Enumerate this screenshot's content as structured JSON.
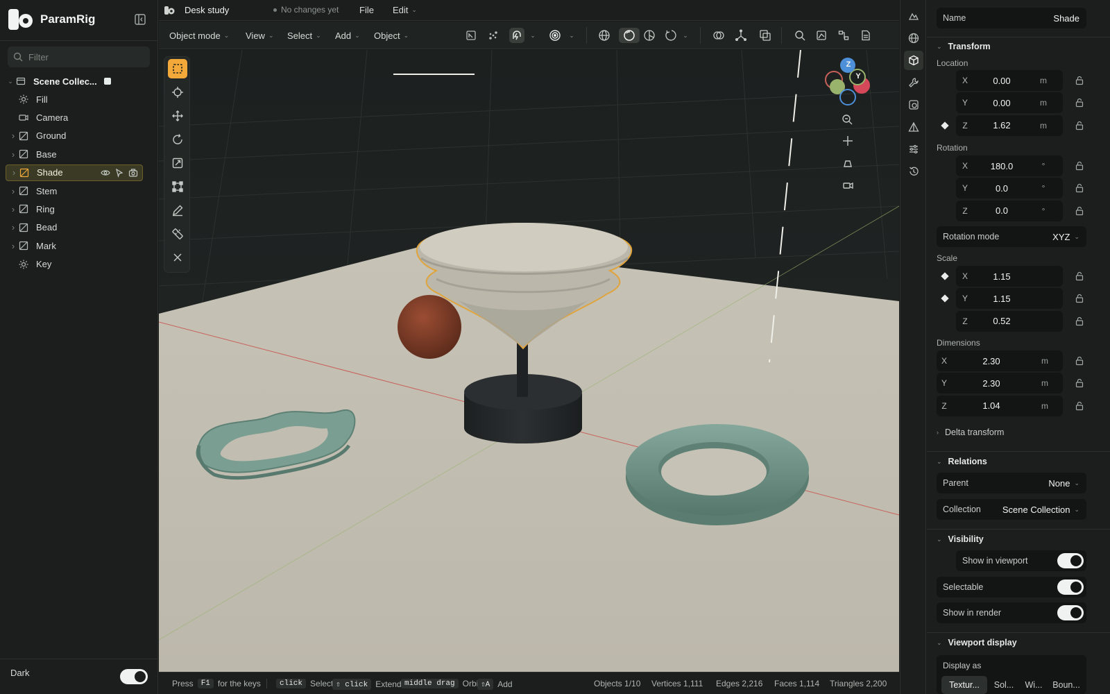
{
  "app": {
    "name": "ParamRig",
    "document_title": "Desk study",
    "save_status": "No changes yet"
  },
  "menus": {
    "file": "File",
    "edit": "Edit"
  },
  "sidebar": {
    "filter_placeholder": "Filter",
    "collection": "Scene Collec...",
    "items": [
      {
        "label": "Fill",
        "icon": "light-icon",
        "expandable": false
      },
      {
        "label": "Camera",
        "icon": "camera-icon",
        "expandable": false
      },
      {
        "label": "Ground",
        "icon": "mesh-icon",
        "expandable": true
      },
      {
        "label": "Base",
        "icon": "mesh-icon",
        "expandable": true
      },
      {
        "label": "Shade",
        "icon": "mesh-icon",
        "expandable": true,
        "selected": true
      },
      {
        "label": "Stem",
        "icon": "mesh-icon",
        "expandable": true
      },
      {
        "label": "Ring",
        "icon": "mesh-icon",
        "expandable": true
      },
      {
        "label": "Bead",
        "icon": "mesh-icon",
        "expandable": true
      },
      {
        "label": "Mark",
        "icon": "mesh-icon",
        "expandable": true
      },
      {
        "label": "Key",
        "icon": "light-icon",
        "expandable": false
      }
    ],
    "theme_label": "Dark",
    "theme_dark": true
  },
  "toolbar": {
    "mode": "Object mode",
    "view": "View",
    "select": "Select",
    "add": "Add",
    "object": "Object"
  },
  "viewport": {
    "gizmo": {
      "z": "Z",
      "y": "Y"
    },
    "selected_color": "#f2a93a"
  },
  "status": {
    "press": "Press",
    "f1": "F1",
    "for_keys": "for the keys",
    "hints": [
      {
        "key": "click",
        "action": "Select"
      },
      {
        "key": "⇧ click",
        "action": "Extend"
      },
      {
        "key": "middle drag",
        "action": "Orbit"
      },
      {
        "key": "⇧A",
        "action": "Add"
      }
    ],
    "objects": "Objects 1/10",
    "vertices": "Vertices 1,111",
    "edges": "Edges 2,216",
    "faces": "Faces 1,114",
    "triangles": "Triangles 2,200"
  },
  "properties": {
    "name_label": "Name",
    "name_value": "Shade",
    "transform_title": "Transform",
    "location_label": "Location",
    "location": [
      {
        "axis": "X",
        "value": "0.00",
        "unit": "m",
        "keyframed": false
      },
      {
        "axis": "Y",
        "value": "0.00",
        "unit": "m",
        "keyframed": false
      },
      {
        "axis": "Z",
        "value": "1.62",
        "unit": "m",
        "keyframed": true
      }
    ],
    "rotation_label": "Rotation",
    "rotation": [
      {
        "axis": "X",
        "value": "180.0",
        "unit": "°"
      },
      {
        "axis": "Y",
        "value": "0.0",
        "unit": "°"
      },
      {
        "axis": "Z",
        "value": "0.0",
        "unit": "°"
      }
    ],
    "rotation_mode_label": "Rotation mode",
    "rotation_mode_value": "XYZ",
    "scale_label": "Scale",
    "scale": [
      {
        "axis": "X",
        "value": "1.15",
        "keyframed": true
      },
      {
        "axis": "Y",
        "value": "1.15",
        "keyframed": true
      },
      {
        "axis": "Z",
        "value": "0.52",
        "keyframed": false
      }
    ],
    "dimensions_label": "Dimensions",
    "dimensions": [
      {
        "axis": "X",
        "value": "2.30",
        "unit": "m"
      },
      {
        "axis": "Y",
        "value": "2.30",
        "unit": "m"
      },
      {
        "axis": "Z",
        "value": "1.04",
        "unit": "m"
      }
    ],
    "delta_transform": "Delta transform",
    "relations_title": "Relations",
    "parent_label": "Parent",
    "parent_value": "None",
    "collection_label": "Collection",
    "collection_value": "Scene Collection",
    "visibility_title": "Visibility",
    "show_viewport": "Show in viewport",
    "selectable": "Selectable",
    "show_render": "Show in render",
    "viewport_display_title": "Viewport display",
    "display_as": "Display as",
    "display_options": [
      "Textur...",
      "Sol...",
      "Wi...",
      "Boun..."
    ]
  }
}
